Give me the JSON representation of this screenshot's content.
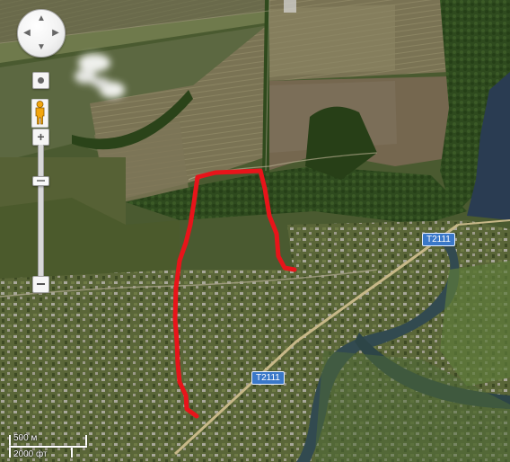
{
  "map": {
    "type": "satellite",
    "route_color": "#e8141a"
  },
  "controls": {
    "pan_icons": [
      "chevron-up-icon",
      "chevron-down-icon",
      "chevron-left-icon",
      "chevron-right-icon"
    ],
    "pan_up": "▲",
    "pan_down": "▼",
    "pan_left": "◀",
    "pan_right": "▶",
    "zoom_in": "+",
    "zoom_level_fraction": 0.27
  },
  "roads": {
    "shield_color": "#3a78c8",
    "label_a": "T2111",
    "label_b": "T2111"
  },
  "scale": {
    "metric": "500 м",
    "imperial": "2000 фт"
  }
}
